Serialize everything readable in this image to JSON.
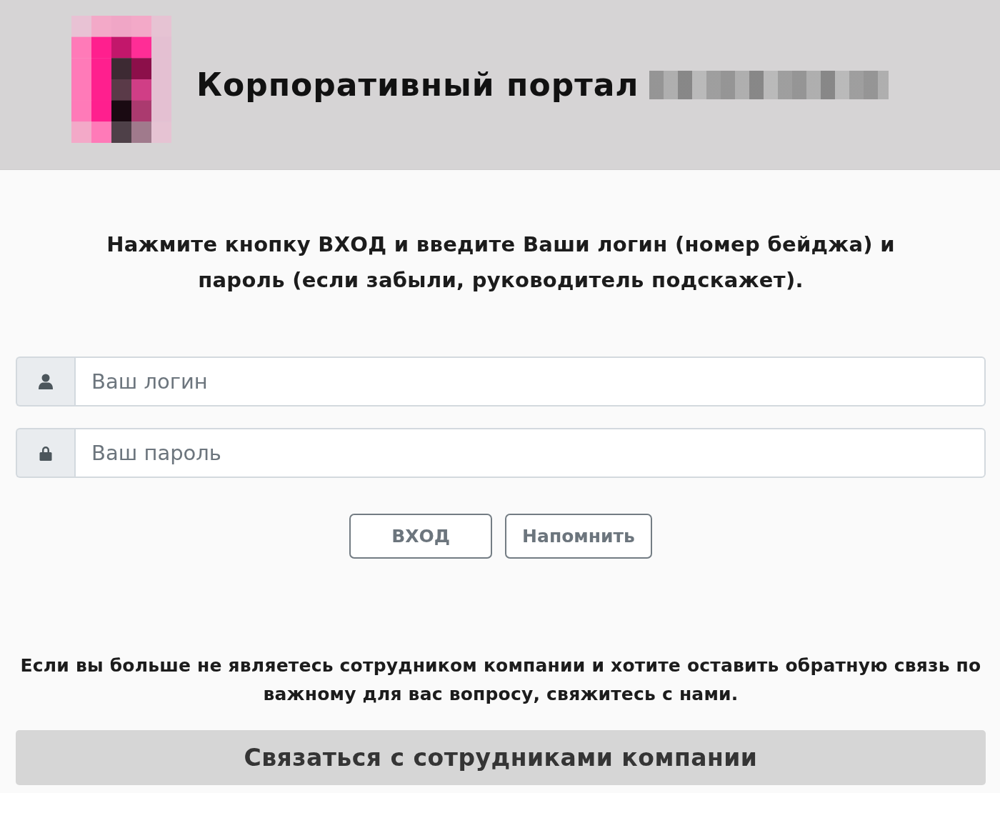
{
  "header": {
    "title": "Корпоративный портал"
  },
  "instruction": "Нажмите кнопку ВХОД и введите Ваши логин (номер бейджа) и пароль (если забыли, руководитель подскажет).",
  "form": {
    "fields": [
      {
        "kind": "login",
        "placeholder": "Ваш логин"
      },
      {
        "kind": "password",
        "placeholder": "Ваш пароль"
      }
    ],
    "buttons": [
      "ВХОД",
      "Напомнить"
    ]
  },
  "footer": {
    "note": "Если вы больше не являетесь сотрудником компании и хотите оставить обратную связь по важному для вас вопросу, свяжитесь с нами.",
    "contact_button": "Связаться с сотрудниками компании"
  }
}
